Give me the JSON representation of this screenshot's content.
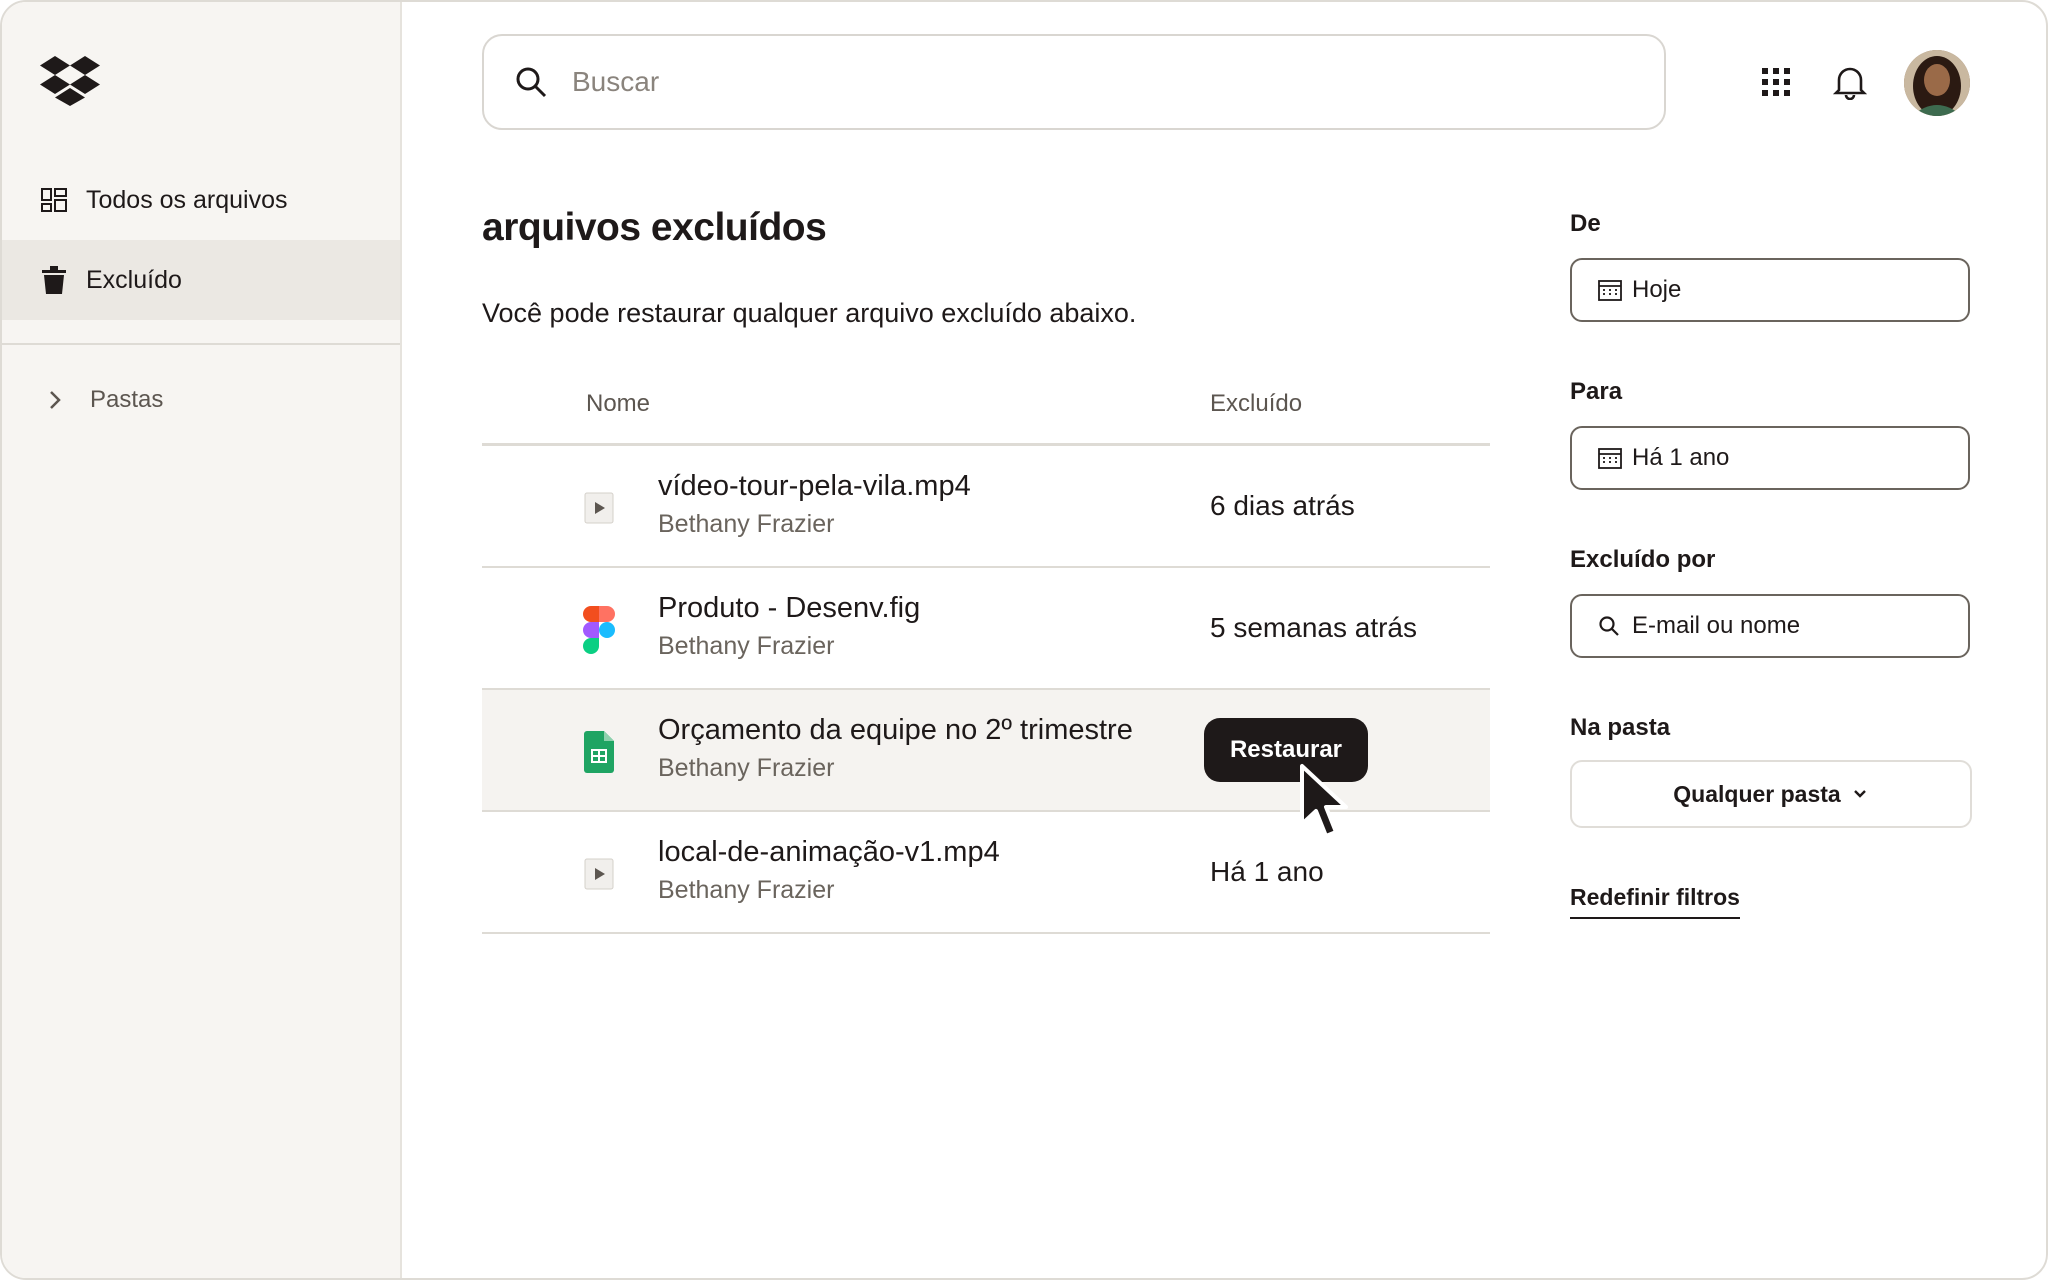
{
  "sidebar": {
    "items": [
      {
        "label": "Todos os arquivos",
        "icon": "all-files-icon"
      },
      {
        "label": "Excluído",
        "icon": "trash-icon"
      }
    ],
    "folders_label": "Pastas"
  },
  "search": {
    "placeholder": "Buscar"
  },
  "main": {
    "title": "arquivos excluídos",
    "description": "Você pode restaurar qualquer arquivo excluído abaixo.",
    "columns": {
      "name": "Nome",
      "deleted": "Excluído"
    },
    "files": [
      {
        "name": "vídeo-tour-pela-vila.mp4",
        "owner": "Bethany Frazier",
        "deleted": "6 dias atrás",
        "icon": "video-file-icon"
      },
      {
        "name": "Produto - Desenv.fig",
        "owner": "Bethany Frazier",
        "deleted": "5 semanas atrás",
        "icon": "figma-icon"
      },
      {
        "name": "Orçamento da equipe no 2º trimestre",
        "owner": "Bethany Frazier",
        "deleted": "",
        "icon": "spreadsheet-icon",
        "action": "Restaurar"
      },
      {
        "name": "local-de-animação-v1.mp4",
        "owner": "Bethany Frazier",
        "deleted": "Há 1 ano",
        "icon": "video-file-icon"
      }
    ]
  },
  "filters": {
    "from_label": "De",
    "from_value": "Hoje",
    "to_label": "Para",
    "to_value": "Há 1 ano",
    "deleted_by_label": "Excluído por",
    "deleted_by_placeholder": "E-mail ou nome",
    "folder_label": "Na pasta",
    "folder_value": "Qualquer pasta",
    "reset_label": "Redefinir filtros"
  },
  "colors": {
    "accent": "#1e1919",
    "sidebar_bg": "#f7f5f2",
    "hover_row": "#f5f3f0"
  }
}
